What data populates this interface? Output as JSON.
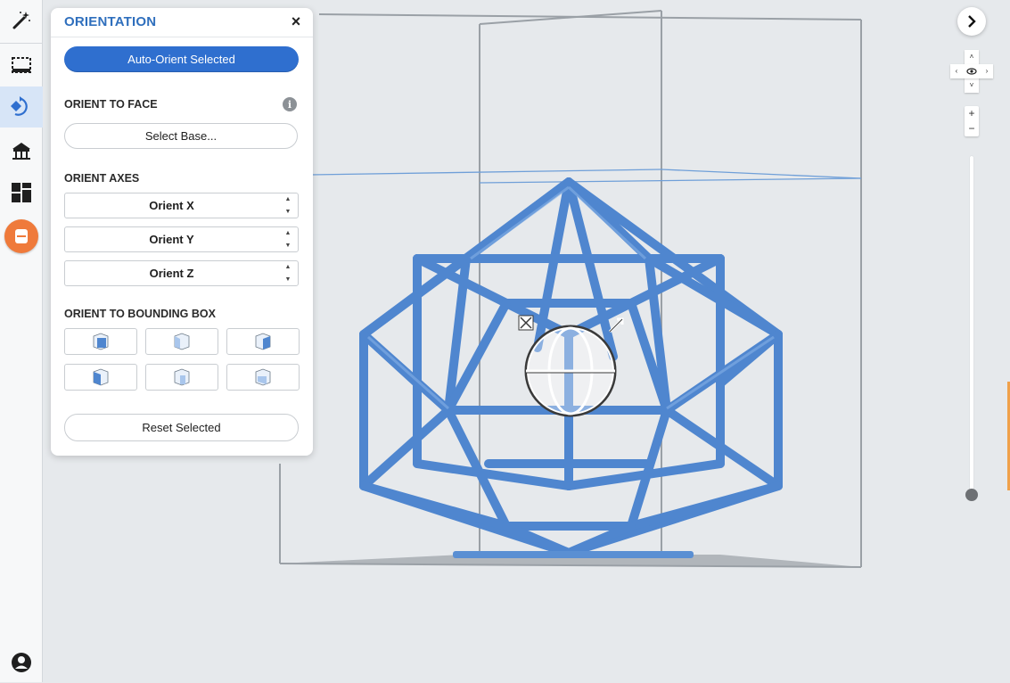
{
  "toolbar": {
    "tools": [
      {
        "icon": "magic-wand-icon"
      },
      {
        "icon": "selection-box-icon"
      },
      {
        "icon": "orientation-icon",
        "active": true
      },
      {
        "icon": "supports-icon"
      },
      {
        "icon": "layout-icon"
      },
      {
        "icon": "print-job-icon"
      }
    ],
    "account_icon": "account-icon"
  },
  "panel": {
    "title": "ORIENTATION",
    "close_label": "×",
    "auto_orient_label": "Auto-Orient Selected",
    "orient_to_face": {
      "label": "ORIENT TO FACE",
      "select_base_label": "Select Base..."
    },
    "orient_axes": {
      "label": "ORIENT AXES",
      "items": [
        {
          "label": "Orient X"
        },
        {
          "label": "Orient Y"
        },
        {
          "label": "Orient Z"
        }
      ]
    },
    "orient_to_bounding_box": {
      "label": "ORIENT TO BOUNDING BOX",
      "faces": [
        "front",
        "back",
        "right",
        "left",
        "top",
        "bottom"
      ]
    },
    "reset_label": "Reset Selected"
  },
  "viewport": {
    "model_color": "#4f86cf",
    "bbox_color": "#9aa0a6",
    "plane_color": "#6f9fd8"
  },
  "navigation": {
    "slider_level": 1.0
  },
  "colors": {
    "accent_blue": "#2f6fcf",
    "title_blue": "#2f6fbd",
    "orange": "#ef7a3b"
  }
}
